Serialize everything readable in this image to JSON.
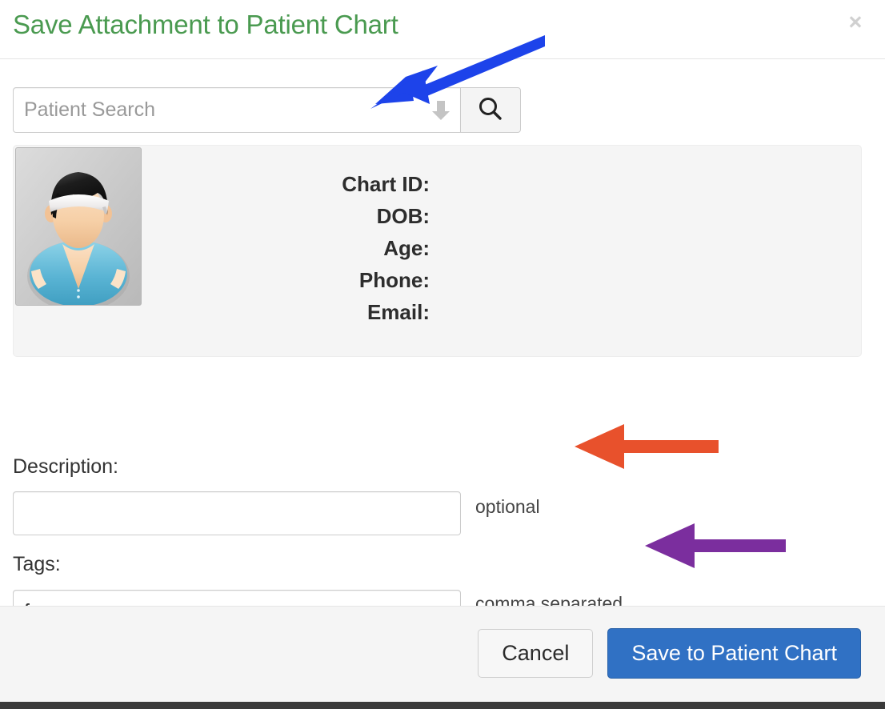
{
  "modal": {
    "title": "Save Attachment to Patient Chart",
    "close_label": "×",
    "close_icon": "close-icon"
  },
  "search": {
    "placeholder": "Patient Search",
    "value": "",
    "dropdown_icon": "arrow-down-icon",
    "button_icon": "search-icon"
  },
  "patient": {
    "avatar_icon": "patient-avatar-icon",
    "fields": [
      {
        "label": "Chart ID:",
        "value": ""
      },
      {
        "label": "DOB:",
        "value": ""
      },
      {
        "label": "Age:",
        "value": ""
      },
      {
        "label": "Phone:",
        "value": ""
      },
      {
        "label": "Email:",
        "value": ""
      }
    ]
  },
  "form": {
    "description": {
      "label": "Description:",
      "value": "",
      "placeholder": "",
      "hint": "optional"
    },
    "tags": {
      "label": "Tags:",
      "value": "fax",
      "placeholder": "",
      "hint": "comma separated"
    }
  },
  "footer": {
    "cancel_label": "Cancel",
    "save_label": "Save to Patient Chart"
  },
  "annotations": [
    {
      "name": "blue-arrow-to-patient-search",
      "color": "#1d43ea",
      "points_to": "patient-search-input"
    },
    {
      "name": "orange-arrow-to-optional-hint",
      "color": "#e8512c",
      "points_to": "description-hint"
    },
    {
      "name": "purple-arrow-to-comma-separated-hint",
      "color": "#7b2e9e",
      "points_to": "tags-hint"
    }
  ],
  "colors": {
    "title_green": "#4a9a50",
    "primary_blue": "#3071c4",
    "panel_gray": "#f5f5f5",
    "arrow_blue": "#1d43ea",
    "arrow_orange": "#e8512c",
    "arrow_purple": "#7b2e9e"
  }
}
